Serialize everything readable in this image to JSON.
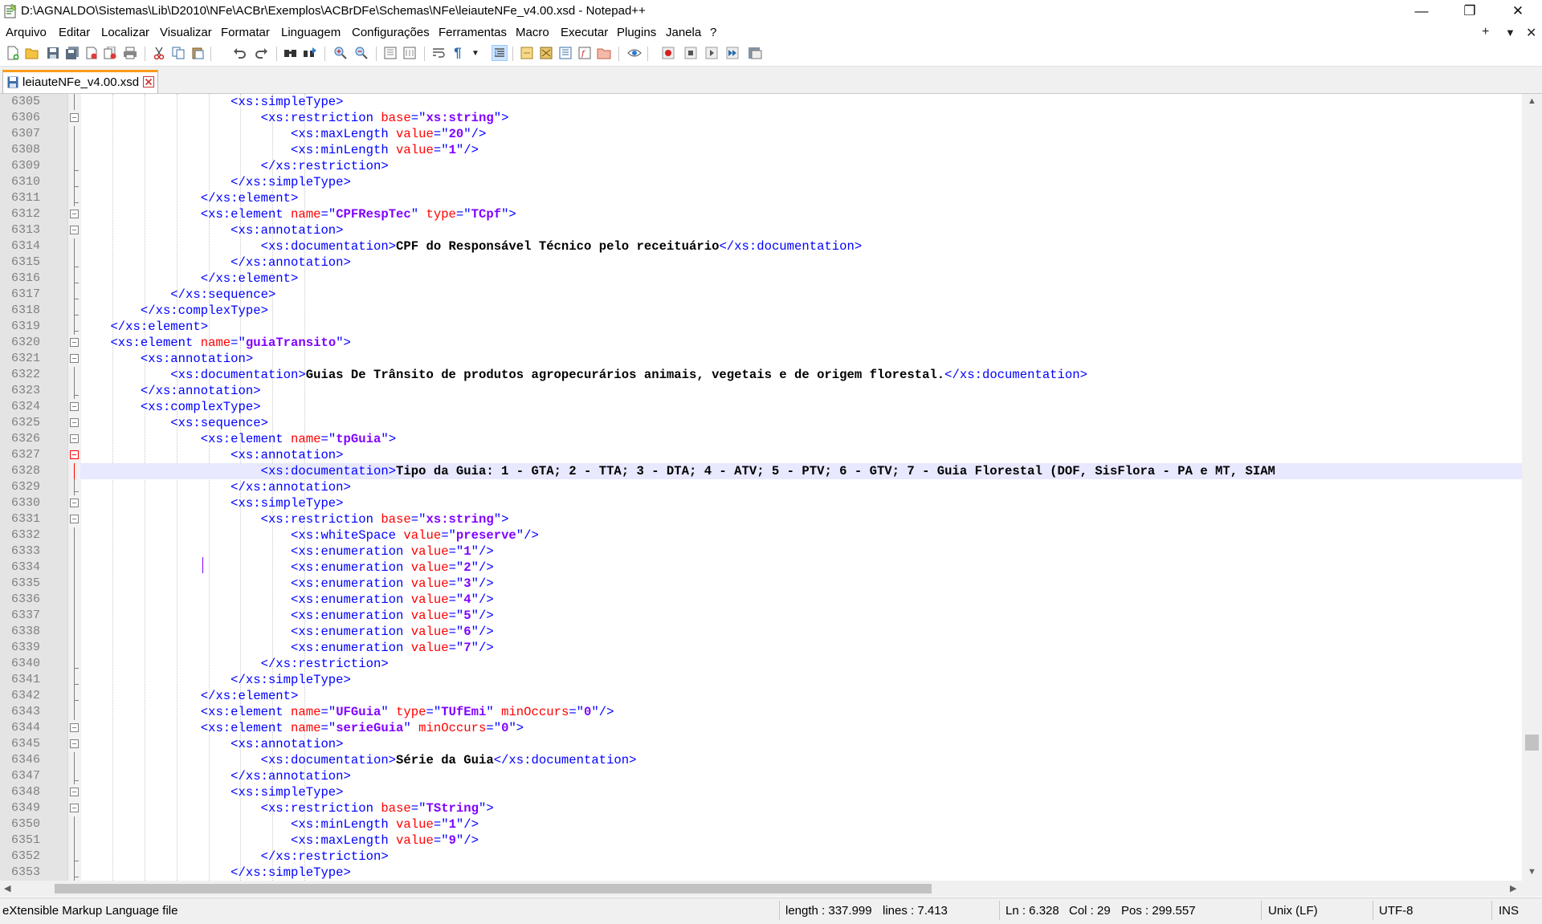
{
  "window": {
    "title": "D:\\AGNALDO\\Sistemas\\Lib\\D2010\\NFe\\ACBr\\Exemplos\\ACBrDFe\\Schemas\\NFe\\leiauteNFe_v4.00.xsd - Notepad++",
    "controls": {
      "minimize": "—",
      "restore": "❐",
      "close": "✕"
    }
  },
  "menu": {
    "items": [
      "Arquivo",
      "Editar",
      "Localizar",
      "Visualizar",
      "Formatar",
      "Linguagem",
      "Configurações",
      "Ferramentas",
      "Macro",
      "Executar",
      "Plugins",
      "Janela",
      "?"
    ],
    "right": {
      "plus": "+",
      "dropdown": "▼",
      "close": "✕"
    }
  },
  "tab": {
    "label": "leiauteNFe_v4.00.xsd"
  },
  "editor": {
    "current_line": 6328,
    "lines": [
      {
        "n": "6305",
        "ind": 10,
        "s": [
          [
            "t",
            "<xs:simpleType>"
          ]
        ]
      },
      {
        "n": "6306",
        "ind": 12,
        "s": [
          [
            "t",
            "<xs:restriction "
          ],
          [
            "a",
            "base"
          ],
          [
            "t",
            "=\""
          ],
          [
            "v",
            "xs:string"
          ],
          [
            "t",
            "\">"
          ]
        ]
      },
      {
        "n": "6307",
        "ind": 14,
        "s": [
          [
            "t",
            "<xs:maxLength "
          ],
          [
            "a",
            "value"
          ],
          [
            "t",
            "=\""
          ],
          [
            "v",
            "20"
          ],
          [
            "t",
            "\"/>"
          ]
        ]
      },
      {
        "n": "6308",
        "ind": 14,
        "s": [
          [
            "t",
            "<xs:minLength "
          ],
          [
            "a",
            "value"
          ],
          [
            "t",
            "=\""
          ],
          [
            "v",
            "1"
          ],
          [
            "t",
            "\"/>"
          ]
        ]
      },
      {
        "n": "6309",
        "ind": 12,
        "s": [
          [
            "t",
            "</xs:restriction>"
          ]
        ]
      },
      {
        "n": "6310",
        "ind": 10,
        "s": [
          [
            "t",
            "</xs:simpleType>"
          ]
        ]
      },
      {
        "n": "6311",
        "ind": 8,
        "s": [
          [
            "t",
            "</xs:element>"
          ]
        ]
      },
      {
        "n": "6312",
        "ind": 8,
        "s": [
          [
            "t",
            "<xs:element "
          ],
          [
            "a",
            "name"
          ],
          [
            "t",
            "=\""
          ],
          [
            "v",
            "CPFRespTec"
          ],
          [
            "t",
            "\" "
          ],
          [
            "a",
            "type"
          ],
          [
            "t",
            "=\""
          ],
          [
            "v",
            "TCpf"
          ],
          [
            "t",
            "\">"
          ]
        ]
      },
      {
        "n": "6313",
        "ind": 10,
        "s": [
          [
            "t",
            "<xs:annotation>"
          ]
        ]
      },
      {
        "n": "6314",
        "ind": 12,
        "s": [
          [
            "t",
            "<xs:documentation>"
          ],
          [
            "x",
            "CPF do Responsável Técnico pelo receituário"
          ],
          [
            "t",
            "</xs:documentation>"
          ]
        ]
      },
      {
        "n": "6315",
        "ind": 10,
        "s": [
          [
            "t",
            "</xs:annotation>"
          ]
        ]
      },
      {
        "n": "6316",
        "ind": 8,
        "s": [
          [
            "t",
            "</xs:element>"
          ]
        ]
      },
      {
        "n": "6317",
        "ind": 6,
        "s": [
          [
            "t",
            "</xs:sequence>"
          ]
        ]
      },
      {
        "n": "6318",
        "ind": 4,
        "s": [
          [
            "t",
            "</xs:complexType>"
          ]
        ]
      },
      {
        "n": "6319",
        "ind": 2,
        "s": [
          [
            "t",
            "</xs:element>"
          ]
        ]
      },
      {
        "n": "6320",
        "ind": 2,
        "s": [
          [
            "t",
            "<xs:element "
          ],
          [
            "a",
            "name"
          ],
          [
            "t",
            "=\""
          ],
          [
            "v",
            "guiaTransito"
          ],
          [
            "t",
            "\">"
          ]
        ]
      },
      {
        "n": "6321",
        "ind": 4,
        "s": [
          [
            "t",
            "<xs:annotation>"
          ]
        ]
      },
      {
        "n": "6322",
        "ind": 6,
        "s": [
          [
            "t",
            "<xs:documentation>"
          ],
          [
            "x",
            "Guias De Trânsito de produtos agropecurários animais, vegetais e de origem florestal."
          ],
          [
            "t",
            "</xs:documentation>"
          ]
        ]
      },
      {
        "n": "6323",
        "ind": 4,
        "s": [
          [
            "t",
            "</xs:annotation>"
          ]
        ]
      },
      {
        "n": "6324",
        "ind": 4,
        "s": [
          [
            "t",
            "<xs:complexType>"
          ]
        ]
      },
      {
        "n": "6325",
        "ind": 6,
        "s": [
          [
            "t",
            "<xs:sequence>"
          ]
        ]
      },
      {
        "n": "6326",
        "ind": 8,
        "s": [
          [
            "t",
            "<xs:element "
          ],
          [
            "a",
            "name"
          ],
          [
            "t",
            "=\""
          ],
          [
            "v",
            "tpGuia"
          ],
          [
            "t",
            "\">"
          ]
        ]
      },
      {
        "n": "6327",
        "ind": 10,
        "s": [
          [
            "t",
            "<xs:annotation>"
          ]
        ]
      },
      {
        "n": "6328",
        "ind": 12,
        "s": [
          [
            "t",
            "<xs:documentation>"
          ],
          [
            "x",
            "Tipo da Guia: 1 - GTA; 2 - TTA; 3 - DTA; 4 - ATV; 5 - PTV; 6 - GTV; 7 - Guia Florestal (DOF, SisFlora - PA e MT, SIAM"
          ]
        ]
      },
      {
        "n": "6329",
        "ind": 10,
        "s": [
          [
            "t",
            "</xs:annotation>"
          ]
        ]
      },
      {
        "n": "6330",
        "ind": 10,
        "s": [
          [
            "t",
            "<xs:simpleType>"
          ]
        ]
      },
      {
        "n": "6331",
        "ind": 12,
        "s": [
          [
            "t",
            "<xs:restriction "
          ],
          [
            "a",
            "base"
          ],
          [
            "t",
            "=\""
          ],
          [
            "v",
            "xs:string"
          ],
          [
            "t",
            "\">"
          ]
        ]
      },
      {
        "n": "6332",
        "ind": 14,
        "s": [
          [
            "t",
            "<xs:whiteSpace "
          ],
          [
            "a",
            "value"
          ],
          [
            "t",
            "=\""
          ],
          [
            "v",
            "preserve"
          ],
          [
            "t",
            "\"/>"
          ]
        ]
      },
      {
        "n": "6333",
        "ind": 14,
        "s": [
          [
            "t",
            "<xs:enumeration "
          ],
          [
            "a",
            "value"
          ],
          [
            "t",
            "=\""
          ],
          [
            "v",
            "1"
          ],
          [
            "t",
            "\"/>"
          ]
        ]
      },
      {
        "n": "6334",
        "ind": 14,
        "s": [
          [
            "t",
            "<xs:enumeration "
          ],
          [
            "a",
            "value"
          ],
          [
            "t",
            "=\""
          ],
          [
            "v",
            "2"
          ],
          [
            "t",
            "\"/>"
          ]
        ]
      },
      {
        "n": "6335",
        "ind": 14,
        "s": [
          [
            "t",
            "<xs:enumeration "
          ],
          [
            "a",
            "value"
          ],
          [
            "t",
            "=\""
          ],
          [
            "v",
            "3"
          ],
          [
            "t",
            "\"/>"
          ]
        ]
      },
      {
        "n": "6336",
        "ind": 14,
        "s": [
          [
            "t",
            "<xs:enumeration "
          ],
          [
            "a",
            "value"
          ],
          [
            "t",
            "=\""
          ],
          [
            "v",
            "4"
          ],
          [
            "t",
            "\"/>"
          ]
        ]
      },
      {
        "n": "6337",
        "ind": 14,
        "s": [
          [
            "t",
            "<xs:enumeration "
          ],
          [
            "a",
            "value"
          ],
          [
            "t",
            "=\""
          ],
          [
            "v",
            "5"
          ],
          [
            "t",
            "\"/>"
          ]
        ]
      },
      {
        "n": "6338",
        "ind": 14,
        "s": [
          [
            "t",
            "<xs:enumeration "
          ],
          [
            "a",
            "value"
          ],
          [
            "t",
            "=\""
          ],
          [
            "v",
            "6"
          ],
          [
            "t",
            "\"/>"
          ]
        ]
      },
      {
        "n": "6339",
        "ind": 14,
        "s": [
          [
            "t",
            "<xs:enumeration "
          ],
          [
            "a",
            "value"
          ],
          [
            "t",
            "=\""
          ],
          [
            "v",
            "7"
          ],
          [
            "t",
            "\"/>"
          ]
        ]
      },
      {
        "n": "6340",
        "ind": 12,
        "s": [
          [
            "t",
            "</xs:restriction>"
          ]
        ]
      },
      {
        "n": "6341",
        "ind": 10,
        "s": [
          [
            "t",
            "</xs:simpleType>"
          ]
        ]
      },
      {
        "n": "6342",
        "ind": 8,
        "s": [
          [
            "t",
            "</xs:element>"
          ]
        ]
      },
      {
        "n": "6343",
        "ind": 8,
        "s": [
          [
            "t",
            "<xs:element "
          ],
          [
            "a",
            "name"
          ],
          [
            "t",
            "=\""
          ],
          [
            "v",
            "UFGuia"
          ],
          [
            "t",
            "\" "
          ],
          [
            "a",
            "type"
          ],
          [
            "t",
            "=\""
          ],
          [
            "v",
            "TUfEmi"
          ],
          [
            "t",
            "\" "
          ],
          [
            "a",
            "minOccurs"
          ],
          [
            "t",
            "=\""
          ],
          [
            "v",
            "0"
          ],
          [
            "t",
            "\"/>"
          ]
        ]
      },
      {
        "n": "6344",
        "ind": 8,
        "s": [
          [
            "t",
            "<xs:element "
          ],
          [
            "a",
            "name"
          ],
          [
            "t",
            "=\""
          ],
          [
            "v",
            "serieGuia"
          ],
          [
            "t",
            "\" "
          ],
          [
            "a",
            "minOccurs"
          ],
          [
            "t",
            "=\""
          ],
          [
            "v",
            "0"
          ],
          [
            "t",
            "\">"
          ]
        ]
      },
      {
        "n": "6345",
        "ind": 10,
        "s": [
          [
            "t",
            "<xs:annotation>"
          ]
        ]
      },
      {
        "n": "6346",
        "ind": 12,
        "s": [
          [
            "t",
            "<xs:documentation>"
          ],
          [
            "x",
            "Série da Guia"
          ],
          [
            "t",
            "</xs:documentation>"
          ]
        ]
      },
      {
        "n": "6347",
        "ind": 10,
        "s": [
          [
            "t",
            "</xs:annotation>"
          ]
        ]
      },
      {
        "n": "6348",
        "ind": 10,
        "s": [
          [
            "t",
            "<xs:simpleType>"
          ]
        ]
      },
      {
        "n": "6349",
        "ind": 12,
        "s": [
          [
            "t",
            "<xs:restriction "
          ],
          [
            "a",
            "base"
          ],
          [
            "t",
            "=\""
          ],
          [
            "v",
            "TString"
          ],
          [
            "t",
            "\">"
          ]
        ]
      },
      {
        "n": "6350",
        "ind": 14,
        "s": [
          [
            "t",
            "<xs:minLength "
          ],
          [
            "a",
            "value"
          ],
          [
            "t",
            "=\""
          ],
          [
            "v",
            "1"
          ],
          [
            "t",
            "\"/>"
          ]
        ]
      },
      {
        "n": "6351",
        "ind": 14,
        "s": [
          [
            "t",
            "<xs:maxLength "
          ],
          [
            "a",
            "value"
          ],
          [
            "t",
            "=\""
          ],
          [
            "v",
            "9"
          ],
          [
            "t",
            "\"/>"
          ]
        ]
      },
      {
        "n": "6352",
        "ind": 12,
        "s": [
          [
            "t",
            "</xs:restriction>"
          ]
        ]
      },
      {
        "n": "6353",
        "ind": 10,
        "s": [
          [
            "t",
            "</xs:simpleType>"
          ]
        ]
      }
    ],
    "fold_open_lines": [
      "6306",
      "6312",
      "6313",
      "6320",
      "6321",
      "6324",
      "6325",
      "6326",
      "6327",
      "6330",
      "6331",
      "6344",
      "6345",
      "6348",
      "6349"
    ]
  },
  "statusbar": {
    "filetype": "eXtensible Markup Language file",
    "length": "length : 337.999",
    "lines": "lines : 7.413",
    "ln": "Ln : 6.328",
    "col": "Col : 29",
    "pos": "Pos : 299.557",
    "eol": "Unix (LF)",
    "encoding": "UTF-8",
    "mode": "INS"
  },
  "colors": {
    "tag": "#0000ff",
    "attr": "#ff0000",
    "value": "#8000ff",
    "current_line": "#e8e8ff",
    "tab_accent": "#fa9c1b"
  }
}
